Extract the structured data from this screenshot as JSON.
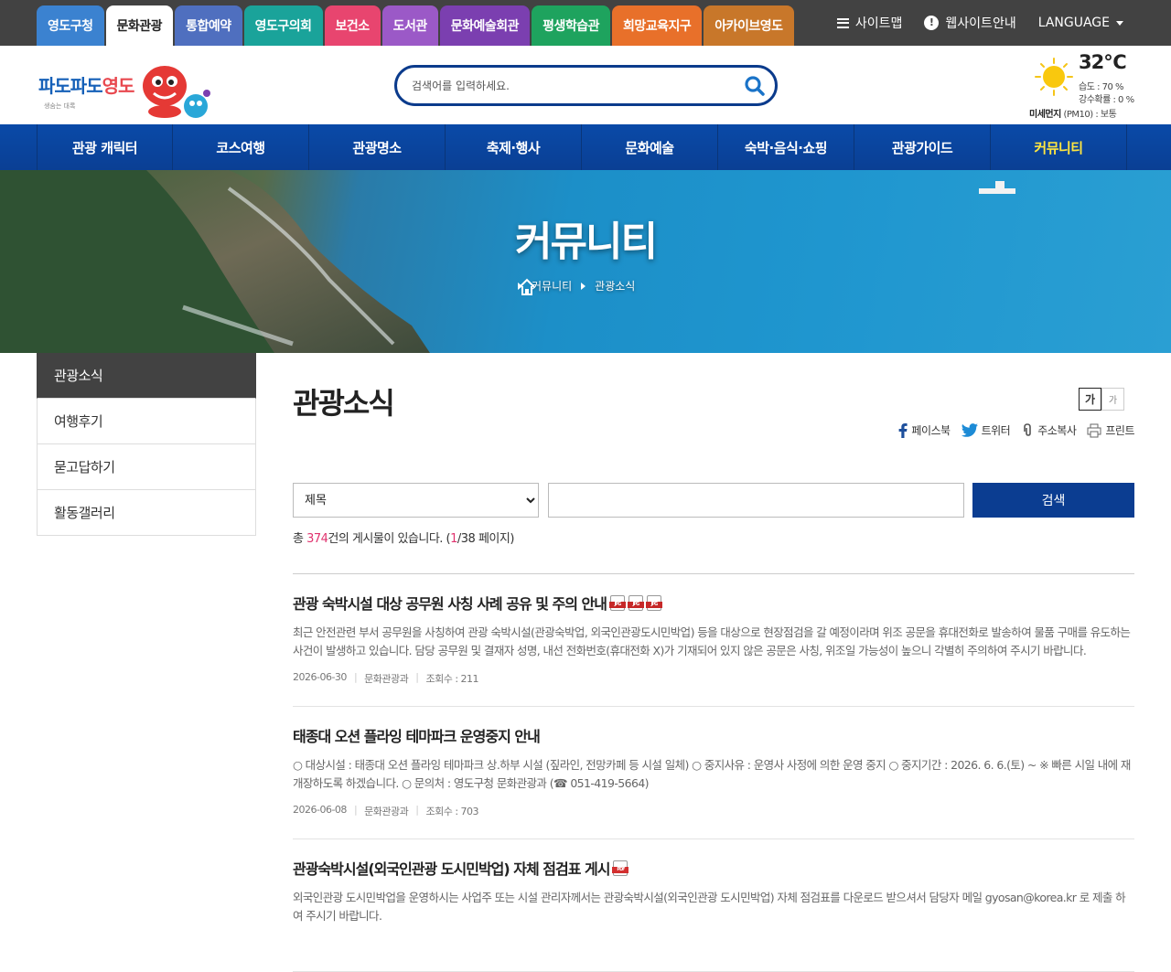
{
  "top_tabs": [
    {
      "label": "영도구청",
      "color": "#3b82d0"
    },
    {
      "label": "문화관광",
      "color": "#ffffff",
      "active": true
    },
    {
      "label": "통합예약",
      "color": "#4f6fbf"
    },
    {
      "label": "영도구의회",
      "color": "#1aa39a"
    },
    {
      "label": "보건소",
      "color": "#e8456f"
    },
    {
      "label": "도서관",
      "color": "#9b59c7"
    },
    {
      "label": "문화예술회관",
      "color": "#7b3fb0"
    },
    {
      "label": "평생학습관",
      "color": "#1ea35e"
    },
    {
      "label": "희망교육지구",
      "color": "#e8702a"
    },
    {
      "label": "아카이브영도",
      "color": "#c8772a"
    }
  ],
  "top_links": {
    "sitemap": "사이트맵",
    "guide": "웹사이트안내",
    "language": "LANGUAGE"
  },
  "logo": {
    "main_a": "파도파도",
    "main_b": "영도",
    "sub": "생숨는 대록"
  },
  "search": {
    "placeholder": "검색어를 입력하세요."
  },
  "weather": {
    "temp": "32℃",
    "humidity": "습도 : 70 %",
    "rain": "강수확률 : 0 %",
    "dust_label": "미세먼지",
    "dust_value": "(PM10) : 보통"
  },
  "nav": [
    "관광 캐릭터",
    "코스여행",
    "관광명소",
    "축제·행사",
    "문화예술",
    "숙박·음식·쇼핑",
    "관광가이드",
    "커뮤니티"
  ],
  "nav_active_index": 7,
  "banner": {
    "title": "커뮤니티",
    "crumb1": "커뮤니티",
    "crumb2": "관광소식"
  },
  "side_menu": [
    {
      "label": "관광소식",
      "active": true
    },
    {
      "label": "여행후기"
    },
    {
      "label": "묻고답하기"
    },
    {
      "label": "활동갤러리"
    }
  ],
  "content": {
    "title": "관광소식",
    "font_large": "가",
    "font_small": "가",
    "share": {
      "facebook": "페이스북",
      "twitter": "트위터",
      "copy": "주소복사",
      "print": "프린트"
    },
    "search_select": "제목",
    "search_button": "검색",
    "count_prefix": "총 ",
    "count_total": "374",
    "count_mid": "건의 게시물이 있습니다. (",
    "count_page": "1",
    "count_suffix": "/38 페이지)"
  },
  "posts": [
    {
      "title": "관광 숙박시설 대상 공무원 사칭 사례 공유 및 주의 안내",
      "files": [
        "JPG",
        "JPG",
        "JPG"
      ],
      "desc": "최근 안전관련 부서 공무원을 사칭하여 관광 숙박시설(관광숙박업, 외국인관광도시민박업) 등을 대상으로 현장점검을 갈 예정이라며 위조 공문을 휴대전화로 발송하여 물품 구매를 유도하는 사건이 발생하고 있습니다. 담당 공무원 및 결재자 성명, 내선 전화번호(휴대전화 X)가 기재되어 있지 않은 공문은 사칭, 위조일 가능성이 높으니 각별히 주의하여 주시기 바랍니다.",
      "date": "2026-06-30",
      "dept": "문화관광과",
      "views": "조회수 : 211"
    },
    {
      "title": "태종대 오션 플라잉 테마파크 운영중지 안내",
      "files": [],
      "desc": "○ 대상시설 : 태종대 오션 플라잉 테마파크 상.하부 시설 (짚라인, 전망카페 등 시설 일체) ○ 중지사유 : 운영사 사정에 의한 운영 중지 ○ 중지기간 : 2026. 6. 6.(토) ~ ※ 빠른 시일 내에 재개장하도록 하겠습니다. ○ 문의처 : 영도구청 문화관광과 (☎ 051-419-5664)",
      "date": "2026-06-08",
      "dept": "문화관광과",
      "views": "조회수 : 703"
    },
    {
      "title": "관광숙박시설(외국인관광 도시민박업) 자체 점검표 게시",
      "files": [
        "PDF"
      ],
      "desc": "외국인관광 도시민박업을 운영하시는 사업주 또는 시설 관리자께서는 관광숙박시설(외국인관광 도시민박업) 자체 점검표를 다운로드 받으셔서 담당자 메일 gyosan@korea.kr 로 제출 하여 주시기 바랍니다.",
      "date": "",
      "dept": "",
      "views": ""
    }
  ]
}
